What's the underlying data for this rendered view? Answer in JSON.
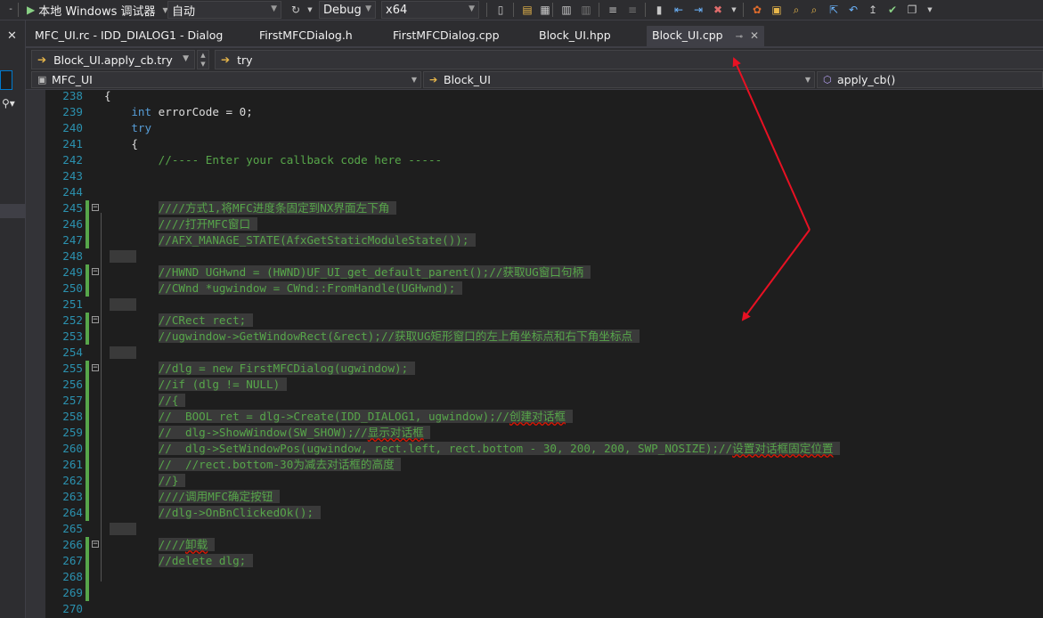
{
  "toolbar": {
    "run_label": "本地 Windows 调试器",
    "config_value": "自动",
    "build_config": "Debug",
    "platform": "x64"
  },
  "tabs": [
    {
      "label": "MFC_UI.rc - IDD_DIALOG1 - Dialog"
    },
    {
      "label": "FirstMFCDialog.h"
    },
    {
      "label": "FirstMFCDialog.cpp"
    },
    {
      "label": "Block_UI.hpp"
    },
    {
      "label": "Block_UI.cpp",
      "active": true
    }
  ],
  "nav": {
    "member": "Block_UI.apply_cb.try",
    "block": "try"
  },
  "scope": {
    "project": "MFC_UI",
    "class": "Block_UI",
    "function": "apply_cb()"
  },
  "code_lines": [
    {
      "n": "238",
      "text": "{",
      "type": "plain"
    },
    {
      "n": "239",
      "text": "    int errorCode = 0;",
      "type": "mixed"
    },
    {
      "n": "240",
      "text": "    try",
      "type": "kw"
    },
    {
      "n": "241",
      "text": "    {",
      "type": "plain"
    },
    {
      "n": "242",
      "text": "        //---- Enter your callback code here -----",
      "type": "cm"
    },
    {
      "n": "243",
      "text": "",
      "type": "plain"
    },
    {
      "n": "244",
      "text": "",
      "type": "plain"
    },
    {
      "n": "245",
      "text": "        ////方式1,将MFC进度条固定到NX界面左下角 ",
      "type": "cm"
    },
    {
      "n": "246",
      "text": "        ////打开MFC窗口 ",
      "type": "cm"
    },
    {
      "n": "247",
      "text": "        //AFX_MANAGE_STATE(AfxGetStaticModuleState()); ",
      "type": "cm"
    },
    {
      "n": "248",
      "text": "",
      "type": "plain"
    },
    {
      "n": "249",
      "text": "        //HWND UGHwnd = (HWND)UF_UI_get_default_parent();//获取UG窗口句柄 ",
      "type": "cm"
    },
    {
      "n": "250",
      "text": "        //CWnd *ugwindow = CWnd::FromHandle(UGHwnd); ",
      "type": "cm"
    },
    {
      "n": "251",
      "text": "",
      "type": "plain"
    },
    {
      "n": "252",
      "text": "        //CRect rect; ",
      "type": "cm"
    },
    {
      "n": "253",
      "text": "        //ugwindow->GetWindowRect(&rect);//获取UG矩形窗口的左上角坐标点和右下角坐标点 ",
      "type": "cm"
    },
    {
      "n": "254",
      "text": "",
      "type": "plain"
    },
    {
      "n": "255",
      "text": "        //dlg = new FirstMFCDialog(ugwindow); ",
      "type": "cm"
    },
    {
      "n": "256",
      "text": "        //if (dlg != NULL) ",
      "type": "cm"
    },
    {
      "n": "257",
      "text": "        //{ ",
      "type": "cm"
    },
    {
      "n": "258",
      "text": "        //  BOOL ret = dlg->Create(IDD_DIALOG1, ugwindow);//创建对话框 ",
      "type": "cm"
    },
    {
      "n": "259",
      "text": "        //  dlg->ShowWindow(SW_SHOW);//显示对话框 ",
      "type": "cm"
    },
    {
      "n": "260",
      "text": "        //  dlg->SetWindowPos(ugwindow, rect.left, rect.bottom - 30, 200, 200, SWP_NOSIZE);//设置对话框固定位置 ",
      "type": "cm"
    },
    {
      "n": "261",
      "text": "        //  //rect.bottom-30为减去对话框的高度 ",
      "type": "cm"
    },
    {
      "n": "262",
      "text": "        //} ",
      "type": "cm"
    },
    {
      "n": "263",
      "text": "        ////调用MFC确定按钮 ",
      "type": "cm"
    },
    {
      "n": "264",
      "text": "        //dlg->OnBnClickedOk(); ",
      "type": "cm"
    },
    {
      "n": "265",
      "text": "",
      "type": "plain"
    },
    {
      "n": "266",
      "text": "        ////卸载 ",
      "type": "cm"
    },
    {
      "n": "267",
      "text": "        //delete dlg; ",
      "type": "cm"
    },
    {
      "n": "268",
      "text": "",
      "type": "plain"
    },
    {
      "n": "269",
      "text": "",
      "type": "plain"
    },
    {
      "n": "270",
      "text": "",
      "type": "plain"
    }
  ],
  "colors": {
    "background": "#1e1e1e",
    "comment": "#57a64a",
    "keyword": "#569cd6",
    "line_number": "#2b91af",
    "annotation_arrow": "#e81123"
  }
}
